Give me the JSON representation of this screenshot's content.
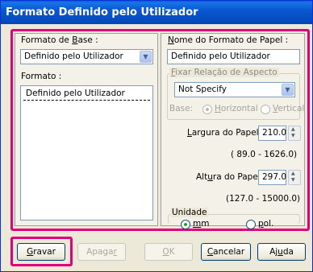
{
  "window": {
    "title": "Formato Definido pelo Utilizador"
  },
  "left": {
    "base_label_pre": "Formato de ",
    "base_label_u": "B",
    "base_label_post": "ase :",
    "base_value": "Definido pelo Utilizador",
    "format_label": "Formato :",
    "format_items": [
      "Definido pelo Utilizador"
    ]
  },
  "right": {
    "name_label_u": "N",
    "name_label_post": "ome do Formato de Papel :",
    "name_value": "Definido pelo Utilizador",
    "aspect_label_u": "F",
    "aspect_label_post": "ixar Relação de Aspecto",
    "aspect_value": "Not Specify",
    "base_label": "Base:",
    "horizontal_label_u": "H",
    "horizontal_label_post": "orizontal",
    "vertical_label_u": "V",
    "vertical_label_post": "ertical",
    "width_label_u": "L",
    "width_label_post": "argura do Papel :",
    "width_value": "210.0",
    "width_range": "( 89.0 - 1626.0)",
    "height_label_pre": "Alt",
    "height_label_u": "u",
    "height_label_post": "ra do Papel :",
    "height_value": "297.0",
    "height_range": "(127.0 - 15000.0)",
    "unit_label": "Unidade",
    "mm_label_u": "m",
    "mm_label_post": "m",
    "pol_label_u": "p",
    "pol_label_post": "ol."
  },
  "buttons": {
    "save_u": "G",
    "save_post": "ravar",
    "delete_pre": "Apaga",
    "delete_u": "r",
    "ok_u": "O",
    "ok_post": "K",
    "cancel_u": "C",
    "cancel_post": "ancelar",
    "help_pre": "Aj",
    "help_u": "u",
    "help_post": "da"
  },
  "colors": {
    "highlight": "#e0007a",
    "titlebar": "#0858d0"
  }
}
